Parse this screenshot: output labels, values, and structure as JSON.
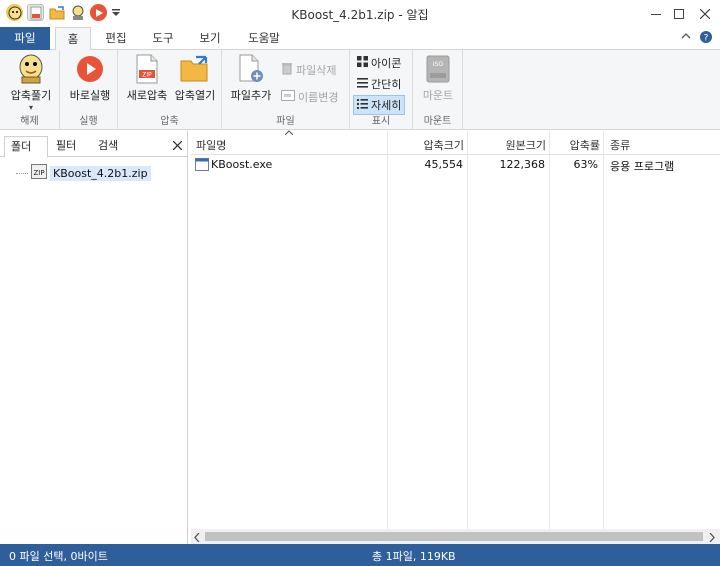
{
  "window": {
    "title": "KBoost_4.2b1.zip - 알집",
    "minimize_icon": "minimize-icon",
    "maximize_icon": "maximize-icon",
    "close_icon": "close-icon"
  },
  "quick_access": [
    "app-icon",
    "new-zip-icon",
    "open-icon",
    "extract-icon",
    "run-icon",
    "customize-icon"
  ],
  "ribbon_tabs": {
    "file": "파일",
    "home": "홈",
    "edit": "편집",
    "tools": "도구",
    "view": "보기",
    "help": "도움말"
  },
  "ribbon": {
    "extract": {
      "label": "압축풀기",
      "group": "해제"
    },
    "run": {
      "label": "바로실행",
      "group": "실행"
    },
    "new_zip": {
      "label": "새로압축"
    },
    "open_zip": {
      "label": "압축열기"
    },
    "compress_group": "압축",
    "add_file": {
      "label": "파일추가"
    },
    "delete_file": {
      "label": "파일삭제"
    },
    "rename": {
      "label": "이름변경"
    },
    "file_group": "파일",
    "view_icon": {
      "label": "아이콘"
    },
    "view_simple": {
      "label": "간단히"
    },
    "view_detail": {
      "label": "자세히"
    },
    "view_group": "표시",
    "mount": {
      "label": "마운트",
      "group": "마운트"
    }
  },
  "left_pane": {
    "tabs": [
      "폴더",
      "필터",
      "검색"
    ],
    "tree_item": "KBoost_4.2b1.zip"
  },
  "file_list": {
    "columns": [
      "파일명",
      "압축크기",
      "원본크기",
      "압축률",
      "종류"
    ],
    "rows": [
      {
        "name": "KBoost.exe",
        "compressed": "45,554",
        "original": "122,368",
        "ratio": "63%",
        "type": "응용 프로그램"
      }
    ]
  },
  "status": {
    "left": "0 파일 선택, 0바이트",
    "right": "총 1파일, 119KB"
  },
  "colors": {
    "accent": "#2f5f9b",
    "selection": "#d9e8fb"
  }
}
